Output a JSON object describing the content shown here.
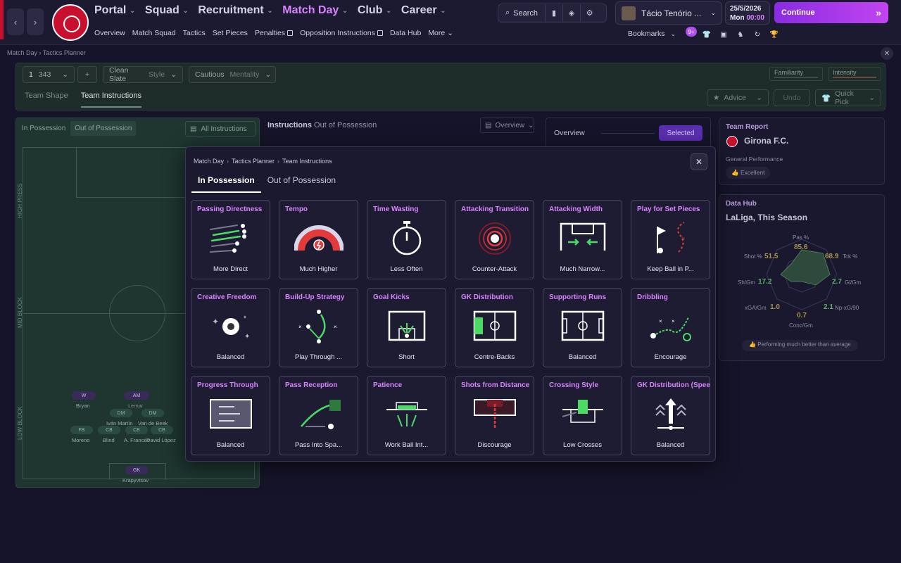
{
  "topbar": {
    "nav": [
      {
        "label": "Portal",
        "active": false
      },
      {
        "label": "Squad",
        "active": false
      },
      {
        "label": "Recruitment",
        "active": false
      },
      {
        "label": "Match Day",
        "active": true
      },
      {
        "label": "Club",
        "active": false
      },
      {
        "label": "Career",
        "active": false
      }
    ],
    "subnav": [
      "Overview",
      "Match Squad",
      "Tactics",
      "Set Pieces",
      "Penalties",
      "Opposition Instructions",
      "Data Hub",
      "More"
    ],
    "search_label": "Search",
    "manager_name": "Tácio Tenório ...",
    "date": "25/5/2026",
    "day": "Mon",
    "time": "00:00",
    "continue_label": "Continue",
    "bookmarks_label": "Bookmarks",
    "notif_count": "9+"
  },
  "breadcrumb": {
    "a": "Match Day",
    "b": "Tactics Planner"
  },
  "toolbar": {
    "formation_num": "1",
    "formation": "343",
    "add": "+",
    "style_value": "Clean Slate",
    "style_label": "Style",
    "mentality_value": "Cautious",
    "mentality_label": "Mentality",
    "familiarity": "Familiarity",
    "intensity": "Intensity",
    "tab_shape": "Team Shape",
    "tab_instructions": "Team Instructions",
    "advice": "Advice",
    "undo": "Undo",
    "quick_pick": "Quick Pick"
  },
  "pitch_panel": {
    "tab_in": "In Possession",
    "tab_out": "Out of Possession",
    "all_instructions": "All Instructions",
    "zones": [
      "HIGH PRESS",
      "MID BLOCK",
      "LOW BLOCK"
    ],
    "players": [
      {
        "pos": "W",
        "name": "Bryan"
      },
      {
        "pos": "AM",
        "name": "Lemar"
      },
      {
        "pos": "DM",
        "name": "Iván Martín"
      },
      {
        "pos": "DM",
        "name": "Van de Beek"
      },
      {
        "pos": "FB",
        "name": "Moreno"
      },
      {
        "pos": "CB",
        "name": "Blind"
      },
      {
        "pos": "CB",
        "name": "A. Francés"
      },
      {
        "pos": "CB",
        "name": "David López"
      },
      {
        "pos": "GK",
        "name": "Krapyvtsov"
      }
    ]
  },
  "middle": {
    "instructions_label": "Instructions",
    "instructions_sub": "Out of Possession",
    "overview_select": "Overview",
    "overview_label": "Overview",
    "selected_label": "Selected"
  },
  "team_report": {
    "title": "Team Report",
    "club": "Girona F.C.",
    "perf_label": "General Performance",
    "perf_value": "Excellent"
  },
  "data_hub": {
    "title": "Data Hub",
    "subtitle": "LaLiga, This Season",
    "footer": "Performing much better than average",
    "stats": [
      {
        "label": "Pas %",
        "value": "85.6"
      },
      {
        "label": "Tck %",
        "value": "68.9"
      },
      {
        "label": "Gl/Gm",
        "value": "2.7"
      },
      {
        "label": "Np-xG/90",
        "value": "2.1"
      },
      {
        "label": "Conc/Gm",
        "value": "0.7"
      },
      {
        "label": "xGA/Gm",
        "value": "1.0"
      },
      {
        "label": "Sh/Gm",
        "value": "17.2"
      },
      {
        "label": "Shot %",
        "value": "51.5"
      }
    ]
  },
  "modal": {
    "crumbs": [
      "Match Day",
      "Tactics Planner",
      "Team Instructions"
    ],
    "tab_in": "In Possession",
    "tab_out": "Out of Possession",
    "cards": [
      {
        "title": "Passing Directness",
        "value": "More Direct",
        "icon": "passing-directness-icon"
      },
      {
        "title": "Tempo",
        "value": "Much Higher",
        "icon": "tempo-gauge-icon"
      },
      {
        "title": "Time Wasting",
        "value": "Less Often",
        "icon": "stopwatch-icon"
      },
      {
        "title": "Attacking Transition",
        "value": "Counter-Attack",
        "icon": "transition-target-icon"
      },
      {
        "title": "Attacking Width",
        "value": "Much Narrow...",
        "icon": "attacking-width-icon"
      },
      {
        "title": "Play for Set Pieces",
        "value": "Keep Ball in P...",
        "icon": "set-piece-icon"
      },
      {
        "title": "Creative Freedom",
        "value": "Balanced",
        "icon": "creative-freedom-icon"
      },
      {
        "title": "Build-Up Strategy",
        "value": "Play Through ...",
        "icon": "build-up-icon"
      },
      {
        "title": "Goal Kicks",
        "value": "Short",
        "icon": "goal-kicks-icon"
      },
      {
        "title": "GK Distribution",
        "value": "Centre-Backs",
        "icon": "gk-distribution-icon"
      },
      {
        "title": "Supporting Runs",
        "value": "Balanced",
        "icon": "supporting-runs-icon"
      },
      {
        "title": "Dribbling",
        "value": "Encourage",
        "icon": "dribbling-icon"
      },
      {
        "title": "Progress Through",
        "value": "Balanced",
        "icon": "progress-through-icon"
      },
      {
        "title": "Pass Reception",
        "value": "Pass Into Spa...",
        "icon": "pass-reception-icon"
      },
      {
        "title": "Patience",
        "value": "Work Ball Int...",
        "icon": "patience-icon"
      },
      {
        "title": "Shots from Distance",
        "value": "Discourage",
        "icon": "shots-distance-icon"
      },
      {
        "title": "Crossing Style",
        "value": "Low Crosses",
        "icon": "crossing-style-icon"
      },
      {
        "title": "GK Distribution (Speed",
        "value": "Balanced",
        "icon": "gk-speed-icon"
      }
    ]
  },
  "colors": {
    "accent": "#d884ff",
    "continue_start": "#8a2be2",
    "continue_end": "#c145f0",
    "pitch": "#1e3530",
    "green": "#4cd964"
  }
}
